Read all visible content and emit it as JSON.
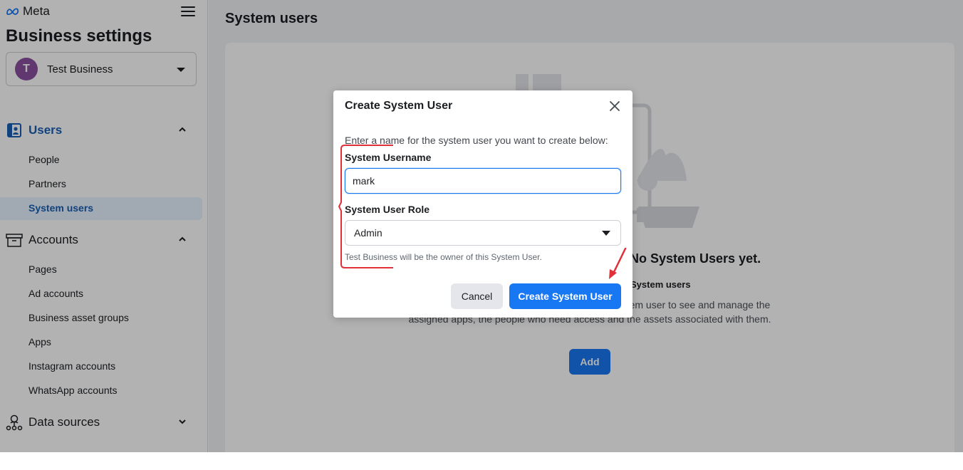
{
  "brand": {
    "name": "Meta"
  },
  "sidebar": {
    "heading": "Business settings",
    "business": {
      "initial": "T",
      "name": "Test Business"
    },
    "sections": {
      "users": {
        "label": "Users",
        "items": [
          "People",
          "Partners",
          "System users"
        ],
        "active": "System users"
      },
      "accounts": {
        "label": "Accounts",
        "items": [
          "Pages",
          "Ad accounts",
          "Business asset groups",
          "Apps",
          "Instagram accounts",
          "WhatsApp accounts"
        ]
      },
      "data_sources": {
        "label": "Data sources"
      }
    }
  },
  "main": {
    "title": "System users",
    "empty_state": {
      "title": "No System Users yet.",
      "subtitle": "System users",
      "description": "System users will be listed here. Click on any system user to see and manage the assigned apps, the people who need access and the assets associated with them.",
      "add_label": "Add"
    }
  },
  "modal": {
    "title": "Create System User",
    "description": "Enter a name for the system user you want to create below:",
    "username_label": "System Username",
    "username_value": "mark",
    "role_label": "System User Role",
    "role_value": "Admin",
    "owner_note": "Test Business will be the owner of this System User.",
    "cancel_label": "Cancel",
    "create_label": "Create System User"
  },
  "colors": {
    "primary": "#1877f2",
    "active_nav": "#1a5fb4",
    "annotation": "#e0303a"
  }
}
